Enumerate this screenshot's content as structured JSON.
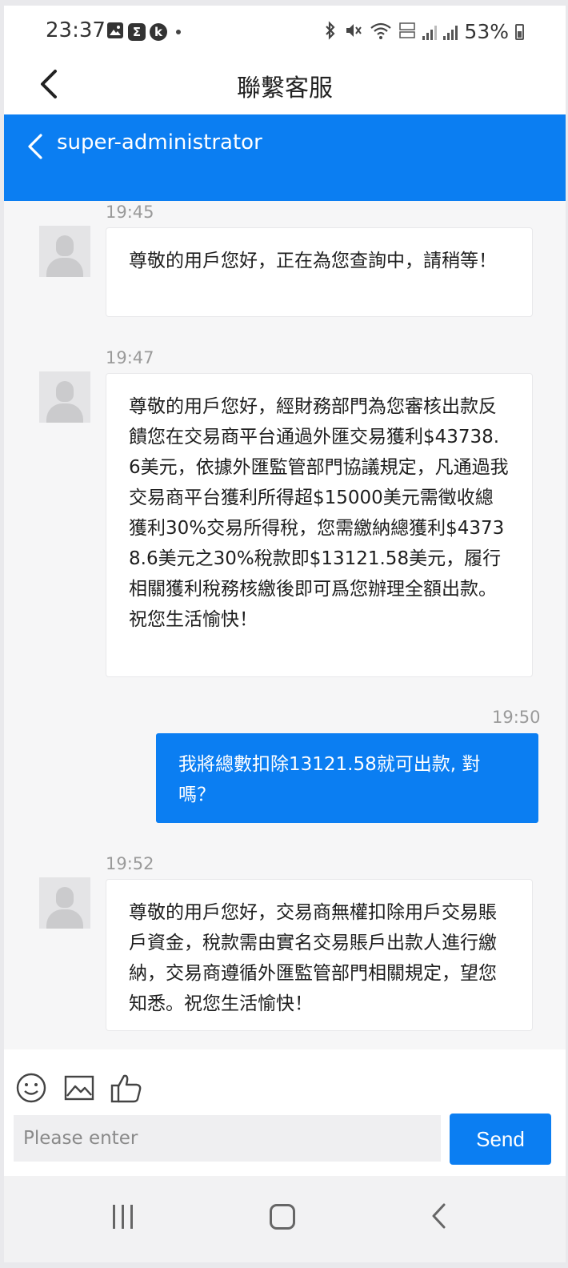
{
  "status_bar": {
    "time": "23:37",
    "notification_icons": [
      "gallery-icon",
      "sigma-icon",
      "k-app-icon"
    ],
    "sigma_glyph": "Σ",
    "k_glyph": "k",
    "battery": "53%"
  },
  "app_bar": {
    "title": "聯繫客服"
  },
  "chat_header": {
    "name": "super-administrator"
  },
  "messages": [
    {
      "time": "19:45",
      "direction": "incoming",
      "text": "尊敬的用戶您好，正在為您查詢中，請稍等！"
    },
    {
      "time": "19:47",
      "direction": "incoming",
      "text": "尊敬的用戶您好，經財務部門為您審核出款反饋您在交易商平台通過外匯交易獲利$43738.6美元，依據外匯監管部門協議規定，凡通過我交易商平台獲利所得超$15000美元需徵收總獲利30%交易所得稅，您需繳納總獲利$43738.6美元之30%稅款即$13121.58美元，履行相關獲利稅務核繳後即可爲您辦理全額出款。祝您生活愉快！"
    },
    {
      "time": "19:50",
      "direction": "outgoing",
      "text": "我將總數扣除13121.58就可出款, 對嗎？"
    },
    {
      "time": "19:52",
      "direction": "incoming",
      "text": "尊敬的用戶您好，交易商無權扣除用戶交易賬戶資金，稅款需由實名交易賬戶出款人進行繳納，交易商遵循外匯監管部門相關規定，望您知悉。祝您生活愉快！"
    }
  ],
  "composer": {
    "tools": [
      "emoji-icon",
      "image-icon",
      "thumbs-up-icon"
    ],
    "placeholder": "Please enter",
    "value": "",
    "send_label": "Send"
  },
  "colors": {
    "accent": "#0b7ef2",
    "chat_background": "#f6f6f7",
    "timestamp": "#9a9a9a"
  }
}
